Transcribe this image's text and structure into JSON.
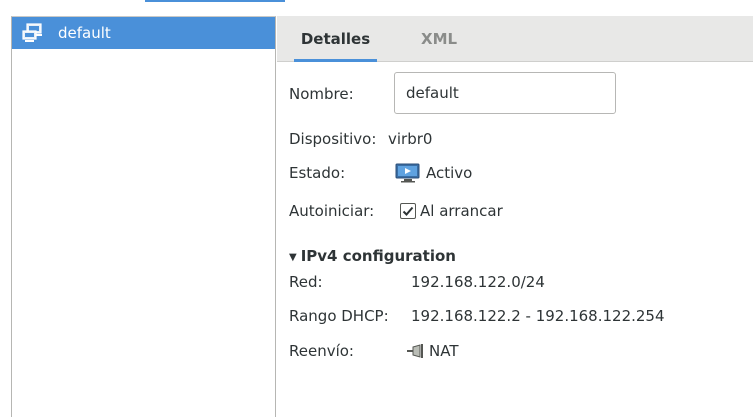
{
  "network_list": {
    "items": [
      {
        "label": "default",
        "icon": "network-icon",
        "selected": true
      }
    ]
  },
  "tabs": [
    {
      "label": "Detalles",
      "active": true
    },
    {
      "label": "XML",
      "active": false
    }
  ],
  "details": {
    "name_label": "Nombre:",
    "name_value": "default",
    "device_label": "Dispositivo:",
    "device_value": "virbr0",
    "state_label": "Estado:",
    "state_value": "Activo",
    "state_icon": "monitor-play-icon",
    "autostart_label": "Autoiniciar:",
    "autostart_value": "Al arrancar",
    "autostart_checked": true
  },
  "ipv4": {
    "section_title": "IPv4 configuration",
    "network_label": "Red:",
    "network_value": "192.168.122.0/24",
    "dhcp_label": "Rango DHCP:",
    "dhcp_value": "192.168.122.2 - 192.168.122.254",
    "forward_label": "Reenvío:",
    "forward_value": "NAT",
    "forward_icon": "plug-icon"
  },
  "colors": {
    "accent": "#4a90d9",
    "text": "#2e3436",
    "tab_background": "#e8e8e7",
    "inactive_tab_text": "#8a8c8a"
  }
}
